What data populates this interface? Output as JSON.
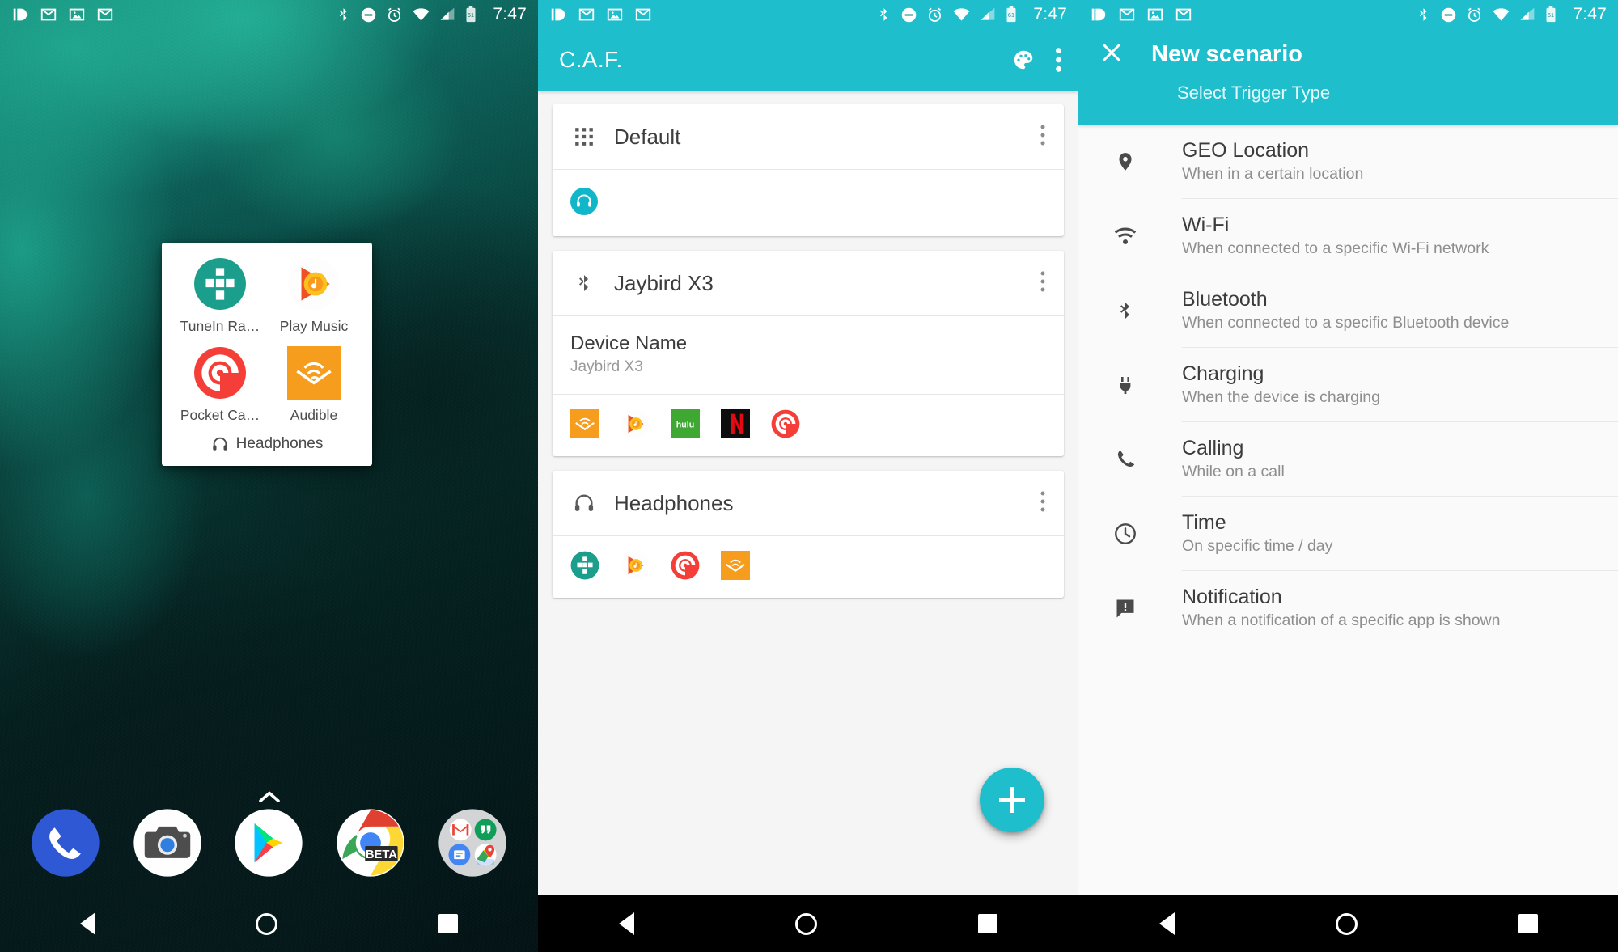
{
  "status_bar": {
    "time": "7:47",
    "battery_text": "61",
    "left_icons": [
      "pushbullet-icon",
      "gmail-icon",
      "photos-icon",
      "gmail-icon"
    ],
    "right_icons": [
      "bluetooth-icon",
      "do-not-disturb-icon",
      "alarm-icon",
      "wifi-icon",
      "signal-icon",
      "battery-icon"
    ]
  },
  "home_screen": {
    "popup": {
      "apps": [
        {
          "label": "TuneIn Ra…",
          "icon": "tunein-radio-icon"
        },
        {
          "label": "Play Music",
          "icon": "play-music-icon"
        },
        {
          "label": "Pocket Ca…",
          "icon": "pocket-casts-icon"
        },
        {
          "label": "Audible",
          "icon": "audible-icon"
        }
      ],
      "footer_label": "Headphones",
      "footer_icon": "headphones-icon"
    },
    "all_apps_chevron": "chevron-up-icon",
    "dock": [
      {
        "name": "Phone",
        "icon": "phone-icon"
      },
      {
        "name": "Camera",
        "icon": "camera-icon"
      },
      {
        "name": "Play Store",
        "icon": "play-store-icon"
      },
      {
        "name": "Chrome Beta",
        "icon": "chrome-beta-icon",
        "badge": "BETA"
      },
      {
        "name": "Google",
        "icon": "google-folder-icon"
      }
    ]
  },
  "caf_app": {
    "title": "C.A.F.",
    "actions": [
      {
        "name": "theme",
        "icon": "palette-icon"
      },
      {
        "name": "overflow",
        "icon": "more-vert-icon"
      }
    ],
    "cards": [
      {
        "icon": "apps-grid-icon",
        "title": "Default",
        "menu_icon": "more-vert-icon",
        "chips": [
          {
            "icon": "headphones-circle-icon",
            "color": "#11b7c8"
          }
        ],
        "apps": []
      },
      {
        "icon": "bluetooth-icon",
        "title": "Jaybird X3",
        "menu_icon": "more-vert-icon",
        "detail_label": "Device Name",
        "detail_value": "Jaybird X3",
        "apps": [
          "audible-icon",
          "play-music-icon",
          "hulu-icon",
          "netflix-icon",
          "pocket-casts-icon"
        ]
      },
      {
        "icon": "headphones-icon",
        "title": "Headphones",
        "menu_icon": "more-vert-icon",
        "apps": [
          "tunein-radio-icon",
          "play-music-icon",
          "pocket-casts-icon",
          "audible-icon"
        ]
      }
    ],
    "fab": {
      "icon": "plus-icon",
      "label": "Add scenario"
    }
  },
  "new_scenario": {
    "close_icon": "close-icon",
    "title": "New scenario",
    "subtitle": "Select Trigger Type",
    "triggers": [
      {
        "icon": "location-pin-icon",
        "title": "GEO Location",
        "subtitle": "When in a certain location"
      },
      {
        "icon": "wifi-icon",
        "title": "Wi-Fi",
        "subtitle": "When connected to a specific Wi-Fi network"
      },
      {
        "icon": "bluetooth-icon",
        "title": "Bluetooth",
        "subtitle": "When connected to a specific Bluetooth device"
      },
      {
        "icon": "power-plug-icon",
        "title": "Charging",
        "subtitle": "When the device is charging"
      },
      {
        "icon": "phone-call-icon",
        "title": "Calling",
        "subtitle": "While on a call"
      },
      {
        "icon": "clock-icon",
        "title": "Time",
        "subtitle": "On specific time / day"
      },
      {
        "icon": "notification-icon",
        "title": "Notification",
        "subtitle": "When a notification of a specific app is shown"
      }
    ]
  },
  "colors": {
    "accent_teal": "#1fbecd",
    "app_background": "#f5f5f5",
    "text_primary": "#3d3d3d",
    "text_secondary": "#9a9a9a"
  }
}
